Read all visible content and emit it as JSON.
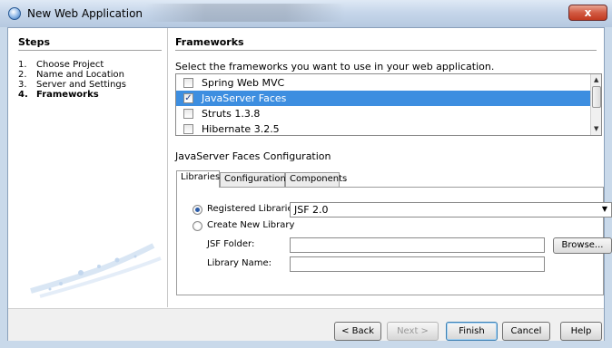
{
  "window": {
    "title": "New Web Application",
    "close_glyph": "x"
  },
  "steps": {
    "heading": "Steps",
    "items": [
      {
        "num": "1.",
        "label": "Choose Project"
      },
      {
        "num": "2.",
        "label": "Name and Location"
      },
      {
        "num": "3.",
        "label": "Server and Settings"
      },
      {
        "num": "4.",
        "label": "Frameworks"
      }
    ]
  },
  "panel": {
    "heading": "Frameworks",
    "prompt": "Select the frameworks you want to use in your web application.",
    "frameworks": [
      {
        "label": "Spring Web MVC",
        "checked": false
      },
      {
        "label": "JavaServer Faces",
        "checked": true,
        "selected": true
      },
      {
        "label": "Struts 1.3.8",
        "checked": false
      },
      {
        "label": "Hibernate 3.2.5",
        "checked": false
      }
    ],
    "config_title": "JavaServer Faces Configuration",
    "tabs": [
      "Libraries",
      "Configuration",
      "Components"
    ],
    "libraries": {
      "registered_label": "Registered Libraries:",
      "registered_value": "JSF 2.0",
      "create_label": "Create New Library",
      "jsf_folder_label": "JSF Folder:",
      "jsf_folder_value": "",
      "library_name_label": "Library Name:",
      "library_name_value": "",
      "browse_label": "Browse..."
    }
  },
  "buttons": {
    "back": "< Back",
    "next": "Next >",
    "finish": "Finish",
    "cancel": "Cancel",
    "help": "Help"
  }
}
